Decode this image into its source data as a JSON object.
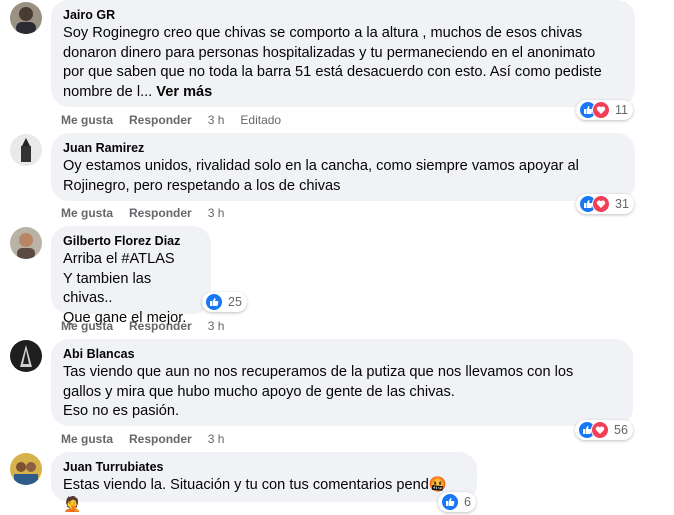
{
  "comments": [
    {
      "author": "Jairo GR",
      "lines": [
        "Soy Roginegro creo que chivas se comporto a la altura , muchos de esos chivas",
        "donaron dinero para personas hospitalizadas y tu permaneciendo en el anonimato",
        "por que saben que no toda la barra 51 está desacuerdo con esto. Así como pediste",
        "nombre de l..."
      ],
      "see_more": "Ver más",
      "reaction_count": "11",
      "like": "Me gusta",
      "reply": "Responder",
      "time": "3 h",
      "edited": "Editado"
    },
    {
      "author": "Juan Ramirez",
      "lines": [
        "Oy estamos unidos, rivalidad solo en la cancha, como siempre vamos apoyar al",
        "Rojinegro, pero respetando a los de chivas"
      ],
      "reaction_count": "31",
      "like": "Me gusta",
      "reply": "Responder",
      "time": "3 h"
    },
    {
      "author": "Gilberto Florez Diaz",
      "lines": [
        "Arriba el #ATLAS",
        "Y tambien las chivas..",
        "Que gane el mejor."
      ],
      "reaction_count": "25",
      "like": "Me gusta",
      "reply": "Responder",
      "time": "3 h"
    },
    {
      "author": "Abi Blancas",
      "lines": [
        "Tas viendo que aun no nos recuperamos de la putiza que nos llevamos con los",
        "gallos y mira que hubo mucho apoyo de gente de las chivas.",
        "Eso no es pasión."
      ],
      "reaction_count": "56",
      "like": "Me gusta",
      "reply": "Responder",
      "time": "3 h"
    },
    {
      "author": "Juan Turrubiates",
      "lines": [
        "Estas viendo la. Situación y tu con tus comentarios pend"
      ],
      "emoji_tail": "🤬🤦",
      "reaction_count": "6"
    }
  ],
  "colors": {
    "bubble_bg": "#f0f2f5",
    "like_blue": "#1877f2",
    "love_red": "#f33e58",
    "meta_gray": "#65676b"
  },
  "icons": [
    "like-reaction-icon",
    "love-reaction-icon"
  ]
}
